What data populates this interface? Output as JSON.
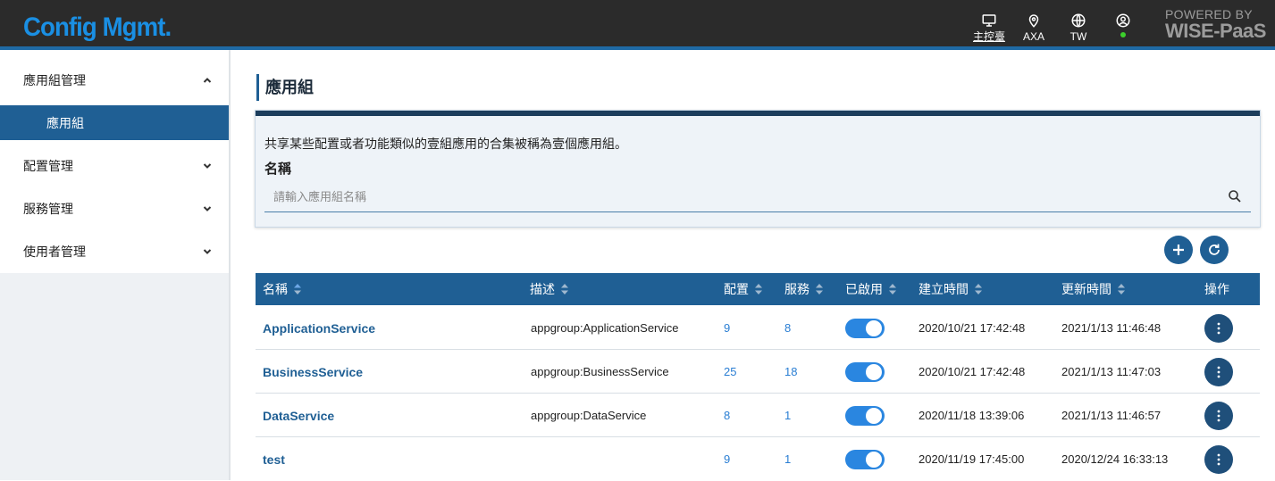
{
  "header": {
    "logo": "Config Mgmt.",
    "items": [
      {
        "label": "主控臺",
        "icon": "monitor-icon"
      },
      {
        "label": "AXA",
        "icon": "location-pin-icon"
      },
      {
        "label": "TW",
        "icon": "globe-icon"
      },
      {
        "label": "",
        "icon": "user-circle-icon"
      }
    ],
    "powered_line1": "POWERED BY",
    "powered_line2": "WISE-PaaS",
    "colors": {
      "bar": "#2b2b2b",
      "accent": "#1f6aa5",
      "logo": "#1a8fe3"
    }
  },
  "sidebar": {
    "items": [
      {
        "label": "應用組管理",
        "expanded": true
      },
      {
        "label": "配置管理",
        "expanded": false
      },
      {
        "label": "服務管理",
        "expanded": false
      },
      {
        "label": "使用者管理",
        "expanded": false
      }
    ],
    "active_sub": "應用組"
  },
  "main": {
    "title": "應用組",
    "description": "共享某些配置或者功能類似的壹組應用的合集被稱為壹個應用組。",
    "search_label": "名稱",
    "search_placeholder": "請輸入應用組名稱",
    "add_icon": "plus-icon",
    "refresh_icon": "refresh-icon"
  },
  "table": {
    "columns": [
      "名稱",
      "描述",
      "配置",
      "服務",
      "已啟用",
      "建立時間",
      "更新時間",
      "操作"
    ],
    "rows": [
      {
        "name": "ApplicationService",
        "desc": "appgroup:ApplicationService",
        "config": "9",
        "service": "8",
        "enabled": true,
        "created": "2020/10/21 17:42:48",
        "updated": "2021/1/13 11:46:48"
      },
      {
        "name": "BusinessService",
        "desc": "appgroup:BusinessService",
        "config": "25",
        "service": "18",
        "enabled": true,
        "created": "2020/10/21 17:42:48",
        "updated": "2021/1/13 11:47:03"
      },
      {
        "name": "DataService",
        "desc": "appgroup:DataService",
        "config": "8",
        "service": "1",
        "enabled": true,
        "created": "2020/11/18 13:39:06",
        "updated": "2021/1/13 11:46:57"
      },
      {
        "name": "test",
        "desc": "",
        "config": "9",
        "service": "1",
        "enabled": true,
        "created": "2020/11/19 17:45:00",
        "updated": "2020/12/24 16:33:13"
      }
    ]
  }
}
